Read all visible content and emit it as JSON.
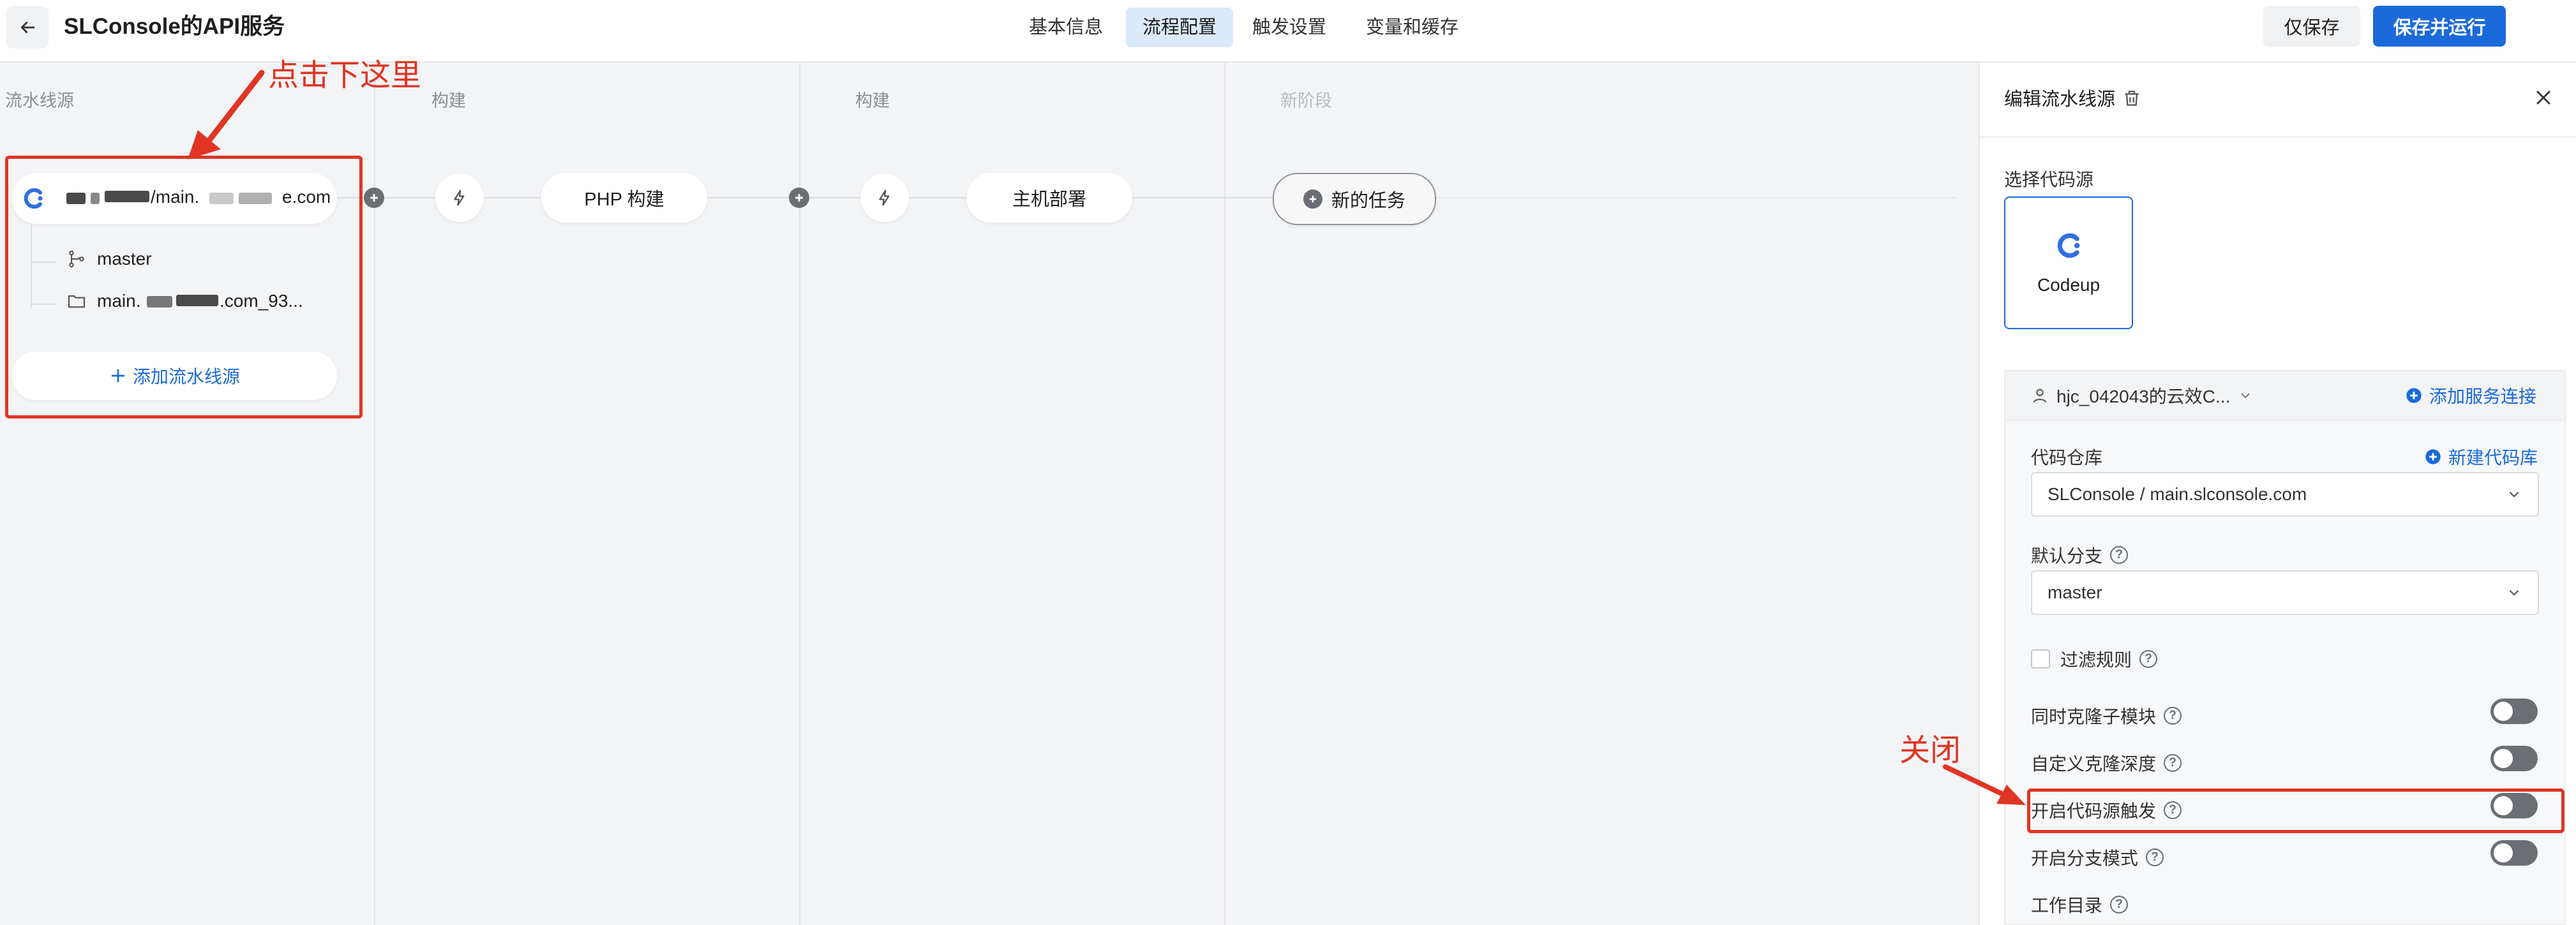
{
  "header": {
    "title": "SLConsole的API服务",
    "tabs": [
      {
        "label": "基本信息",
        "active": false
      },
      {
        "label": "流程配置",
        "active": true
      },
      {
        "label": "触发设置",
        "active": false
      },
      {
        "label": "变量和缓存",
        "active": false
      }
    ],
    "save_label": "仅保存",
    "save_run_label": "保存并运行"
  },
  "pipeline": {
    "stages": [
      {
        "title": "流水线源"
      },
      {
        "title": "构建"
      },
      {
        "title": "构建"
      },
      {
        "title": "新阶段"
      }
    ],
    "source": {
      "repo_text": "/main.",
      "repo_suffix": "e.com",
      "branch": "master",
      "dir_prefix": "main.",
      "dir_suffix": ".com_93..."
    },
    "add_source_label": "添加流水线源",
    "jobs": [
      "PHP 构建",
      "主机部署"
    ],
    "new_task_label": "新的任务"
  },
  "annotations": {
    "click_here": "点击下这里",
    "close": "关闭"
  },
  "panel": {
    "title": "编辑流水线源",
    "select_source_label": "选择代码源",
    "codeup_label": "Codeup",
    "account": "hjc_042043的云效C...",
    "add_service_connection": "添加服务连接",
    "repo_label": "代码仓库",
    "new_repo": "新建代码库",
    "repo_value": "SLConsole / main.slconsole.com",
    "default_branch_label": "默认分支",
    "default_branch_value": "master",
    "filter_rules_label": "过滤规则",
    "toggles": [
      {
        "label": "同时克隆子模块",
        "on": false
      },
      {
        "label": "自定义克隆深度",
        "on": false
      },
      {
        "label": "开启代码源触发",
        "on": false
      },
      {
        "label": "开启分支模式",
        "on": false
      }
    ],
    "workdir_label": "工作目录"
  },
  "colors": {
    "accent": "#1b6ad9",
    "annotation": "#e03524",
    "canvas_bg": "#f3f4f6"
  }
}
